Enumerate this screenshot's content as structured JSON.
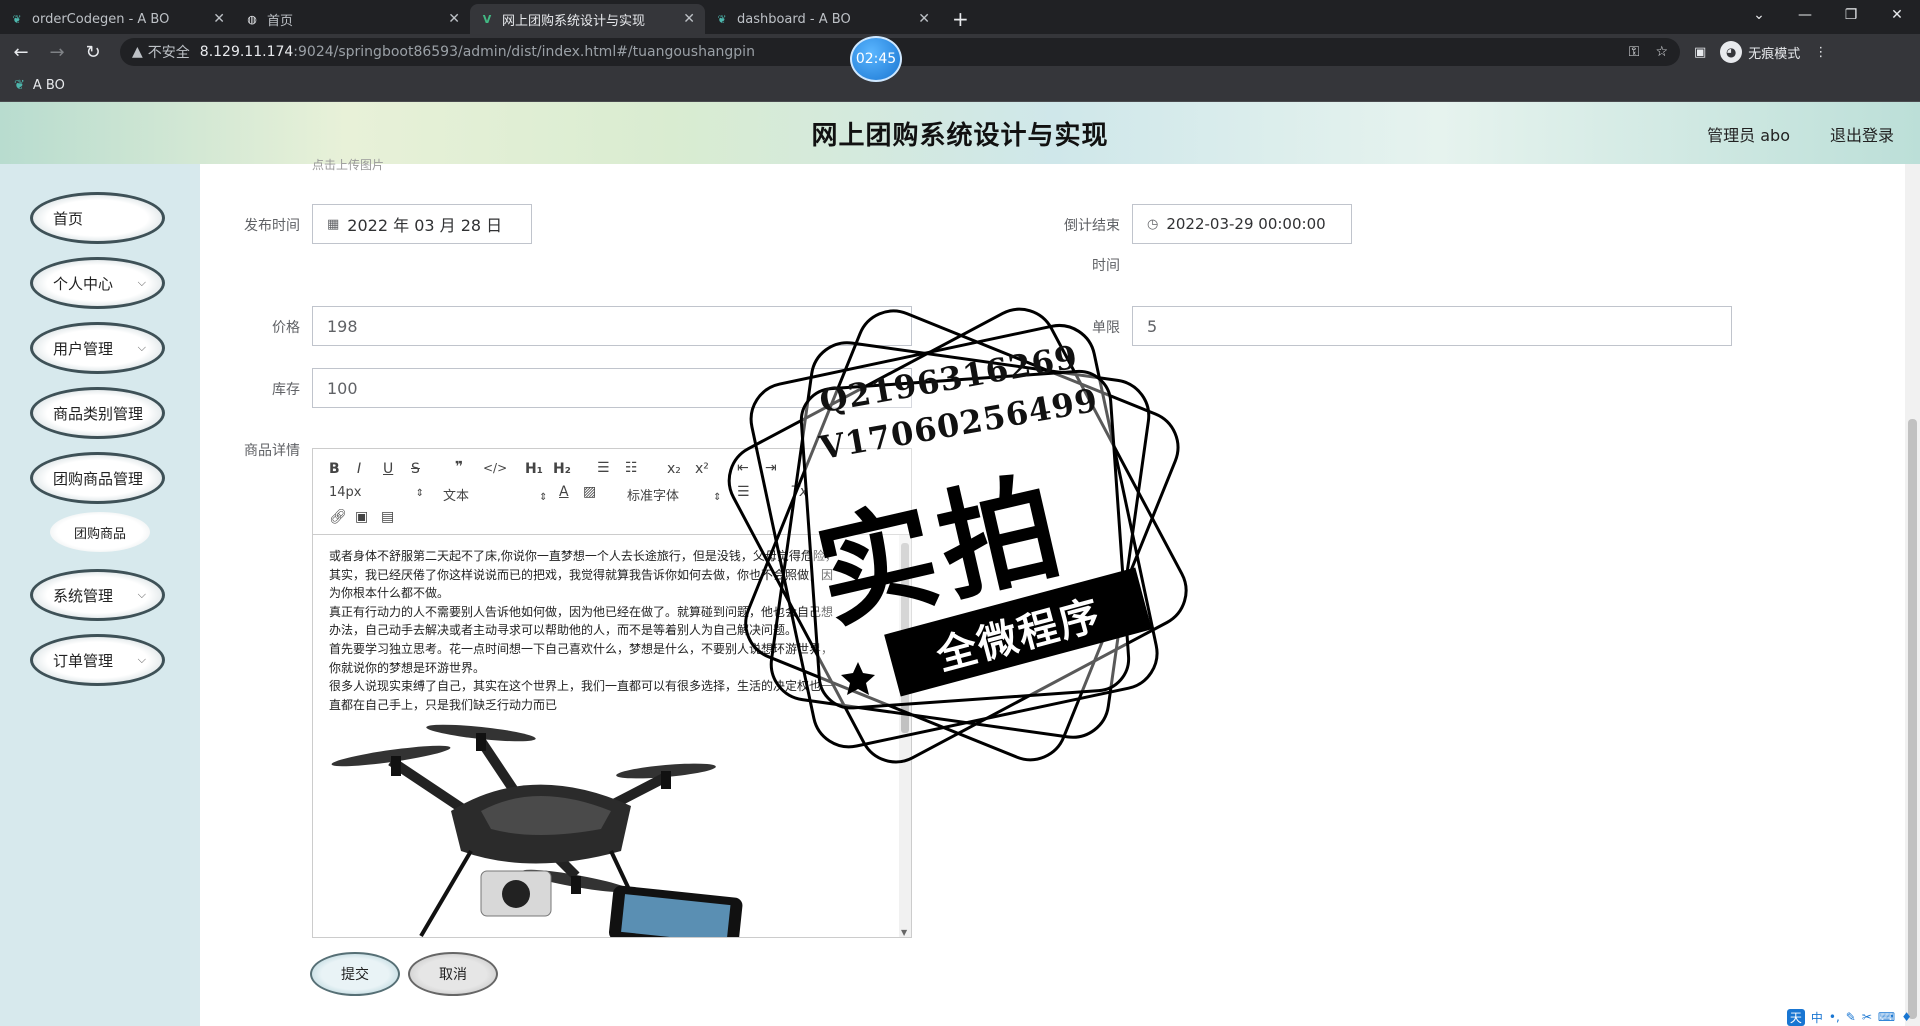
{
  "browser": {
    "tabs": [
      {
        "title": "orderCodegen - A BO",
        "icon": "leaf-icon",
        "active": false
      },
      {
        "title": "首页",
        "icon": "globe-icon",
        "active": false
      },
      {
        "title": "网上团购系统设计与实现",
        "icon": "vue-icon",
        "active": true
      },
      {
        "title": "dashboard - A BO",
        "icon": "leaf-icon",
        "active": false
      }
    ],
    "new_tab": "+",
    "security_label": "不安全",
    "url_host": "8.129.11.174",
    "url_path": ":9024/springboot86593/admin/dist/index.html#/tuangoushangpin",
    "incognito_label": "无痕模式",
    "bookmark": "A BO",
    "timer": "02:45"
  },
  "app": {
    "title": "网上团购系统设计与实现",
    "user": "管理员 abo",
    "logout": "退出登录"
  },
  "sidebar": {
    "items": [
      {
        "label": "首页",
        "has_children": false
      },
      {
        "label": "个人中心",
        "has_children": true
      },
      {
        "label": "用户管理",
        "has_children": true
      },
      {
        "label": "商品类别管理",
        "has_children": false
      },
      {
        "label": "团购商品管理",
        "has_children": false
      },
      {
        "label": "系统管理",
        "has_children": true
      },
      {
        "label": "订单管理",
        "has_children": true
      }
    ],
    "subitem": "团购商品",
    "chevron": "⌵"
  },
  "form": {
    "upload_hint": "点击上传图片",
    "publish_time_label": "发布时间",
    "publish_time_value": "2022 年 03 月 28 日",
    "countdown_label_1": "倒计结束",
    "countdown_label_2": "时间",
    "countdown_value": "2022-03-29 00:00:00",
    "price_label": "价格",
    "price_value": "198",
    "limit_label": "单限",
    "limit_value": "5",
    "stock_label": "库存",
    "stock_value": "100",
    "detail_label": "商品详情",
    "submit": "提交",
    "cancel": "取消"
  },
  "editor": {
    "font_size": "14px",
    "text_style": "文本",
    "font_family": "标准字体",
    "paragraphs": [
      "或者身体不舒服第二天起不了床,你说你一直梦想一个人去长途旅行，但是没钱，父母觉得危险，",
      "其实，我已经厌倦了你这样说说而已的把戏，我觉得就算我告诉你如何去做，你也不会照做，因",
      "为你根本什么都不做。",
      "真正有行动力的人不需要别人告诉他如何做，因为他已经在做了。就算碰到问题，他也会自己想",
      "办法，自己动手去解决或者主动寻求可以帮助他的人，而不是等着别人为自己解决问题。",
      "首先要学习独立思考。花一点时间想一下自己喜欢什么，梦想是什么，不要别人说想环游世界，",
      "你就说你的梦想是环游世界。",
      "很多人说现实束缚了自己，其实在这个世界上，我们一直都可以有很多选择，生活的决定权也一",
      "直都在自己手上，只是我们缺乏行动力而已"
    ]
  },
  "watermark": {
    "line1": "Q2196316269",
    "line2": "V17060256499",
    "big": "实拍",
    "banner": "全微程序"
  },
  "ime": {
    "lang": "天",
    "mode": "中"
  }
}
